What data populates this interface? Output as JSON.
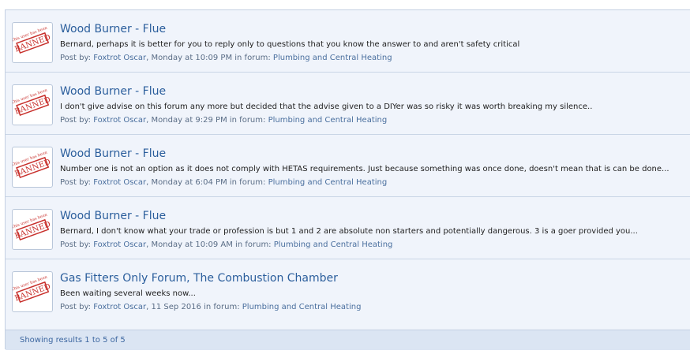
{
  "results": [
    {
      "title": "Wood Burner - Flue",
      "snippet": "Bernard, perhaps it is better for you to reply only to questions that you know the answer to and aren't safety critical",
      "posted_by_label": "Post by: ",
      "author": "Foxtrot Oscar",
      "date": ", Monday at 10:09 PM in forum: ",
      "forum": "Plumbing and Central Heating"
    },
    {
      "title": "Wood Burner - Flue",
      "snippet": "I don't give advise on this forum any more but decided that the advise given to a DIYer was so risky it was worth breaking my silence..",
      "posted_by_label": "Post by: ",
      "author": "Foxtrot Oscar",
      "date": ", Monday at 9:29 PM in forum: ",
      "forum": "Plumbing and Central Heating"
    },
    {
      "title": "Wood Burner - Flue",
      "snippet": "Number one is not an option as it does not comply with HETAS requirements. Just because something was once done, doesn't mean that is can be done...",
      "posted_by_label": "Post by: ",
      "author": "Foxtrot Oscar",
      "date": ", Monday at 6:04 PM in forum: ",
      "forum": "Plumbing and Central Heating"
    },
    {
      "title": "Wood Burner - Flue",
      "snippet": "Bernard, I don't know what your trade or profession is but 1 and 2 are absolute non starters and potentially dangerous. 3 is a goer provided you...",
      "posted_by_label": "Post by: ",
      "author": "Foxtrot Oscar",
      "date": ", Monday at 10:09 AM in forum: ",
      "forum": "Plumbing and Central Heating"
    },
    {
      "title": "Gas Fitters Only Forum, The Combustion Chamber",
      "snippet": "Been waiting several weeks now...",
      "posted_by_label": "Post by: ",
      "author": "Foxtrot Oscar",
      "date": ", 11 Sep 2016 in forum: ",
      "forum": "Plumbing and Central Heating"
    }
  ],
  "avatar": {
    "stamp_text": "BANNED",
    "stamp_small_text": "This user has been",
    "stamp_color": "#c8302c"
  },
  "footer": {
    "label": "Showing results 1 to 5 of 5"
  },
  "colors": {
    "link": "#2b5e9c",
    "background": "#f0f4fb",
    "footer": "#dbe5f3"
  }
}
